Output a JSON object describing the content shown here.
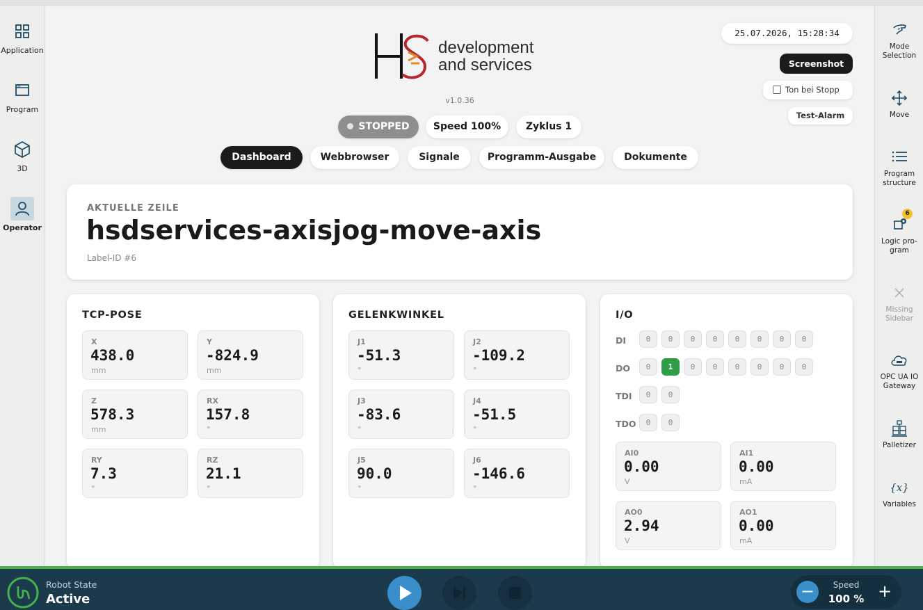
{
  "left_sidebar": [
    {
      "label": "Application",
      "icon": "grid-icon"
    },
    {
      "label": "Program",
      "icon": "window-icon"
    },
    {
      "label": "3D",
      "icon": "cube-icon"
    },
    {
      "label": "Operator",
      "icon": "person-icon",
      "active": true
    }
  ],
  "right_sidebar": [
    {
      "label": "Mode Selection",
      "icon": "hand-icon"
    },
    {
      "label": "Move",
      "icon": "move-arrows-icon"
    },
    {
      "label": "Program structure",
      "icon": "list-icon"
    },
    {
      "label": "Logic pro- gram",
      "icon": "logic-program-icon",
      "badge": "6"
    },
    {
      "label": "Missing Sidebar",
      "icon": "close-icon",
      "disabled": true
    },
    {
      "label": "OPC UA IO Gateway",
      "icon": "cloud-gateway-icon"
    },
    {
      "label": "Palletizer",
      "icon": "palletizer-icon"
    },
    {
      "label": "Variables",
      "icon": "variables-icon",
      "glyph": "{x}"
    }
  ],
  "header": {
    "logo_line1": "development",
    "logo_line2": "and services",
    "version": "v1.0.36",
    "datetime": "25.07.2026, 15:28:34",
    "screenshot_label": "Screenshot",
    "ton_bei_stopp_label": "Ton bei Stopp",
    "test_alarm_label": "Test-Alarm"
  },
  "status": {
    "state": "STOPPED",
    "speed": "Speed 100%",
    "cycle": "Zyklus 1"
  },
  "tabs": [
    "Dashboard",
    "Webbrowser",
    "Signale",
    "Programm-Ausgabe",
    "Dokumente"
  ],
  "current_line": {
    "label": "AKTUELLE ZEILE",
    "title": "hsdservices-axisjog-move-axis",
    "label_id": "Label-ID #6"
  },
  "tcp_pose": {
    "title": "TCP-POSE",
    "values": [
      {
        "name": "X",
        "value": "438.0",
        "unit": "mm"
      },
      {
        "name": "Y",
        "value": "-824.9",
        "unit": "mm"
      },
      {
        "name": "Z",
        "value": "578.3",
        "unit": "mm"
      },
      {
        "name": "RX",
        "value": "157.8",
        "unit": "°"
      },
      {
        "name": "RY",
        "value": "7.3",
        "unit": "°"
      },
      {
        "name": "RZ",
        "value": "21.1",
        "unit": "°"
      }
    ]
  },
  "joints": {
    "title": "GELENKWINKEL",
    "values": [
      {
        "name": "J1",
        "value": "-51.3",
        "unit": "°"
      },
      {
        "name": "J2",
        "value": "-109.2",
        "unit": "°"
      },
      {
        "name": "J3",
        "value": "-83.6",
        "unit": "°"
      },
      {
        "name": "J4",
        "value": "-51.5",
        "unit": "°"
      },
      {
        "name": "J5",
        "value": "90.0",
        "unit": "°"
      },
      {
        "name": "J6",
        "value": "-146.6",
        "unit": "°"
      }
    ]
  },
  "io": {
    "title": "I/O",
    "rows": [
      {
        "label": "DI",
        "bits": [
          "0",
          "0",
          "0",
          "0",
          "0",
          "0",
          "0",
          "0"
        ]
      },
      {
        "label": "DO",
        "bits": [
          "0",
          "1",
          "0",
          "0",
          "0",
          "0",
          "0",
          "0"
        ]
      },
      {
        "label": "TDI",
        "bits": [
          "0",
          "0"
        ]
      },
      {
        "label": "TDO",
        "bits": [
          "0",
          "0"
        ]
      }
    ],
    "analog": [
      {
        "name": "AI0",
        "value": "0.00",
        "unit": "V"
      },
      {
        "name": "AI1",
        "value": "0.00",
        "unit": "mA"
      },
      {
        "name": "AO0",
        "value": "2.94",
        "unit": "V"
      },
      {
        "name": "AO1",
        "value": "0.00",
        "unit": "mA"
      }
    ]
  },
  "bottom_bar": {
    "robot_state_label": "Robot State",
    "robot_state_value": "Active",
    "speed_label": "Speed",
    "speed_value": "100 %"
  },
  "colors": {
    "accent_blue": "#3a8ec9",
    "bottom_bar": "#1b3a4b",
    "status_green": "#47b04b",
    "do_on": "#2e9e48",
    "logo_red": "#b5272d"
  }
}
